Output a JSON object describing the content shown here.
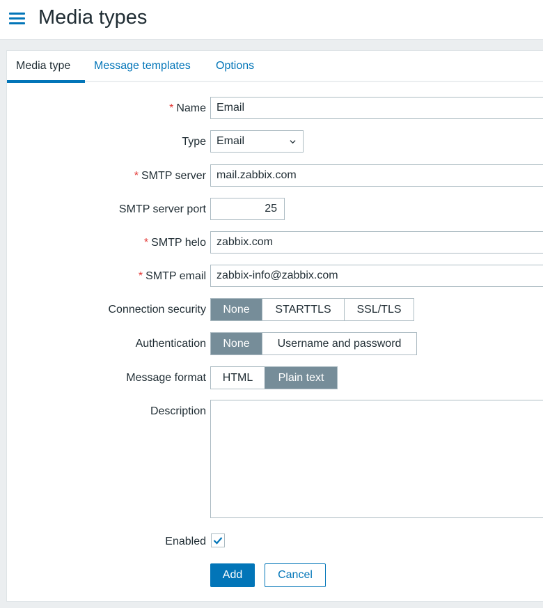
{
  "header": {
    "title": "Media types",
    "menu_icon": "hamburger-menu-icon"
  },
  "tabs": [
    {
      "label": "Media type",
      "active": true
    },
    {
      "label": "Message templates",
      "active": false
    },
    {
      "label": "Options",
      "active": false
    }
  ],
  "form": {
    "name": {
      "label": "Name",
      "required": "*",
      "value": "Email"
    },
    "type": {
      "label": "Type",
      "value": "Email",
      "icon": "chevron-down-icon"
    },
    "smtp_server": {
      "label": "SMTP server",
      "required": "*",
      "value": "mail.zabbix.com"
    },
    "smtp_port": {
      "label": "SMTP server port",
      "value": "25"
    },
    "smtp_helo": {
      "label": "SMTP helo",
      "required": "*",
      "value": "zabbix.com"
    },
    "smtp_email": {
      "label": "SMTP email",
      "required": "*",
      "value": "zabbix-info@zabbix.com"
    },
    "connection_security": {
      "label": "Connection security",
      "options": [
        "None",
        "STARTTLS",
        "SSL/TLS"
      ],
      "selected": "None"
    },
    "authentication": {
      "label": "Authentication",
      "options": [
        "None",
        "Username and password"
      ],
      "selected": "None"
    },
    "message_format": {
      "label": "Message format",
      "options": [
        "HTML",
        "Plain text"
      ],
      "selected": "Plain text"
    },
    "description": {
      "label": "Description",
      "value": ""
    },
    "enabled": {
      "label": "Enabled",
      "checked": true
    }
  },
  "buttons": {
    "add": "Add",
    "cancel": "Cancel"
  },
  "colors": {
    "accent": "#0275b8",
    "selected_segment": "#768d99",
    "required": "#e33734"
  }
}
